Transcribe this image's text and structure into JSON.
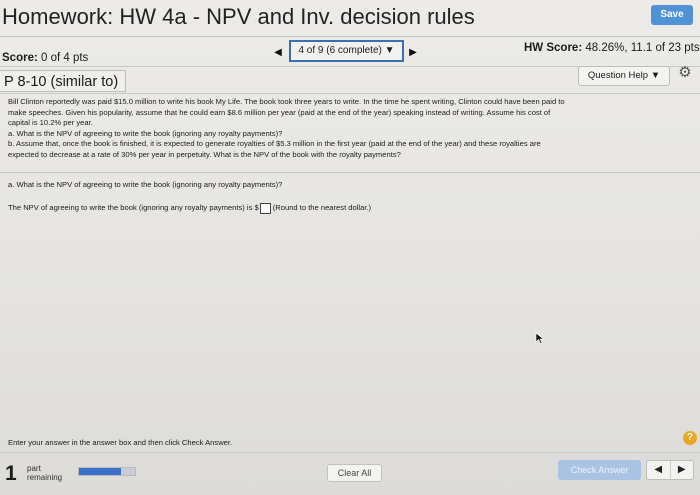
{
  "header": {
    "title": "Homework: HW 4a - NPV and Inv. decision rules",
    "save_label": "Save"
  },
  "status": {
    "score_label": "Score:",
    "score_value": "0 of 4 pts",
    "question_nav": "4 of 9 (6 complete)",
    "hw_score_label": "HW Score:",
    "hw_score_value": "48.26%, 11.1 of 23 pts"
  },
  "problem": {
    "label": "P 8-10 (similar to)",
    "question_help_label": "Question Help",
    "text": [
      "Bill Clinton reportedly was paid $15.0 million to write his book My Life. The book took three years to write. In the time he spent writing, Clinton could have been paid to",
      "make speeches. Given his popularity, assume that he could earn $8.6 million  per year (paid at the end of the year) speaking instead of writing. Assume his cost of",
      "capital is 10.2% per year.",
      "a. What is the NPV of agreeing to write the book (ignoring any royalty payments)?",
      "b. Assume that, once the book is finished, it is expected to generate royalties of $5.3 million in the first year (paid at the end of the year) and these royalties are",
      "expected to decrease at a rate of 30% per year in perpetuity. What is the NPV of the book with the royalty payments?"
    ],
    "part_a_question": "a. What is the NPV of agreeing to write the book (ignoring any royalty payments)?",
    "answer_prefix": "The NPV of agreeing to write the book (ignoring any royalty payments) is $",
    "answer_value": "",
    "answer_suffix": "(Round to the nearest dollar.)"
  },
  "footer": {
    "instruction": "Enter your answer in the answer box and then click Check Answer.",
    "help_label": "?",
    "parts_remaining_num": "1",
    "parts_remaining_line1": "part",
    "parts_remaining_line2": "remaining",
    "progress_fraction": 0.75,
    "clear_all_label": "Clear All",
    "check_answer_label": "Check Answer"
  },
  "icons": {
    "prev": "left-triangle",
    "next": "right-triangle",
    "gear": "gear-icon",
    "cursor": "mouse-pointer"
  },
  "colors": {
    "accent": "#4f93d6",
    "nav_border": "#3b6fb3",
    "help": "#e8a724",
    "progress": "#3b6fc8"
  }
}
